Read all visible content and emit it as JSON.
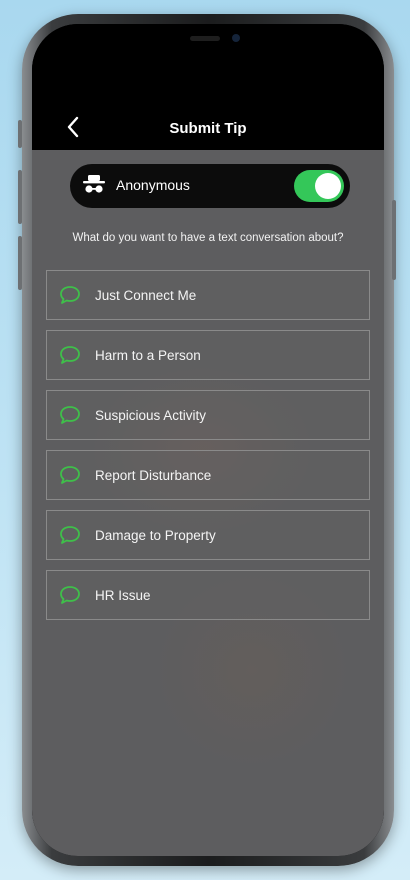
{
  "header": {
    "title": "Submit Tip",
    "back_icon": "chevron-left-icon"
  },
  "anonymous": {
    "label": "Anonymous",
    "icon": "incognito-icon",
    "enabled": true,
    "toggle_color": "#34c759"
  },
  "prompt": "What do you want to have a text conversation about?",
  "options": [
    {
      "label": "Just Connect Me",
      "icon": "chat-bubble-icon"
    },
    {
      "label": "Harm to a Person",
      "icon": "chat-bubble-icon"
    },
    {
      "label": "Suspicious Activity",
      "icon": "chat-bubble-icon"
    },
    {
      "label": "Report Disturbance",
      "icon": "chat-bubble-icon"
    },
    {
      "label": "Damage to Property",
      "icon": "chat-bubble-icon"
    },
    {
      "label": "HR Issue",
      "icon": "chat-bubble-icon"
    }
  ],
  "colors": {
    "accent": "#34c759",
    "icon_green": "#3fbf4a",
    "nav_bg": "#000000",
    "content_bg": "#5d5d5f"
  }
}
